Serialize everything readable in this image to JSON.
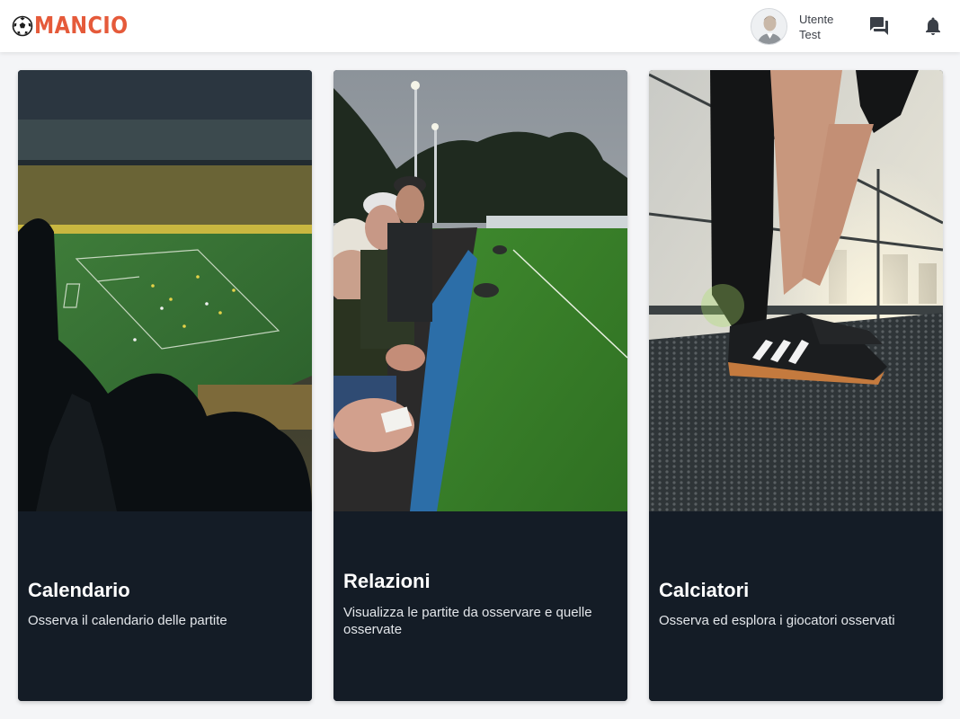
{
  "header": {
    "logo_text": "MANCIO",
    "logo_icon": "soccer-ball-icon",
    "user": {
      "name_line1": "Utente",
      "name_line2": "Test"
    },
    "icons": [
      "chat-icon",
      "bell-icon"
    ]
  },
  "colors": {
    "brand": "#e55a3a",
    "card_background": "#141c26",
    "page_background": "#f4f5f7"
  },
  "cards": [
    {
      "title": "Calendario",
      "description": "Osserva il calendario delle partite",
      "image": "stadium-crowd-photo"
    },
    {
      "title": "Relazioni",
      "description": "Visualizza le partite da osservare e quelle osservate",
      "image": "spectators-at-pitch-photo"
    },
    {
      "title": "Calciatori",
      "description": "Osserva ed esplora i giocatori osservati",
      "image": "player-tying-boots-photo"
    }
  ]
}
